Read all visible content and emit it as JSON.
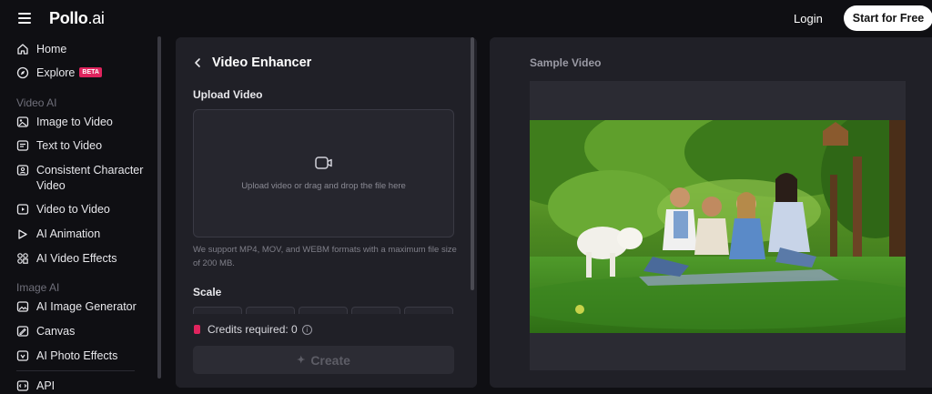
{
  "header": {
    "logo_main": "Pollo",
    "logo_suffix": ".ai",
    "login_label": "Login",
    "start_label": "Start for Free"
  },
  "sidebar": {
    "home": "Home",
    "explore": "Explore",
    "explore_badge": "BETA",
    "section_video": "Video AI",
    "image_to_video": "Image to Video",
    "text_to_video": "Text to Video",
    "consistent_character_line1": "Consistent Character",
    "consistent_character_line2": "Video",
    "video_to_video": "Video to Video",
    "ai_animation": "AI Animation",
    "ai_video_effects": "AI Video Effects",
    "section_image": "Image AI",
    "ai_image_generator": "AI Image Generator",
    "canvas": "Canvas",
    "ai_photo_effects": "AI Photo Effects",
    "api": "API"
  },
  "panel": {
    "title": "Video Enhancer",
    "upload_label": "Upload Video",
    "dropzone_hint": "Upload video or drag and drop the file here",
    "support_text": "We support MP4, MOV, and WEBM formats with a maximum file size of 200 MB.",
    "scale_label": "Scale",
    "credits_label": "Credits required: 0",
    "info_glyph": "i",
    "create_label": "Create",
    "create_glyph": "✦"
  },
  "sample": {
    "title": "Sample Video"
  },
  "colors": {
    "accent_badge": "#e0245e",
    "panel_bg": "#202027",
    "page_bg": "#0f0f13"
  }
}
